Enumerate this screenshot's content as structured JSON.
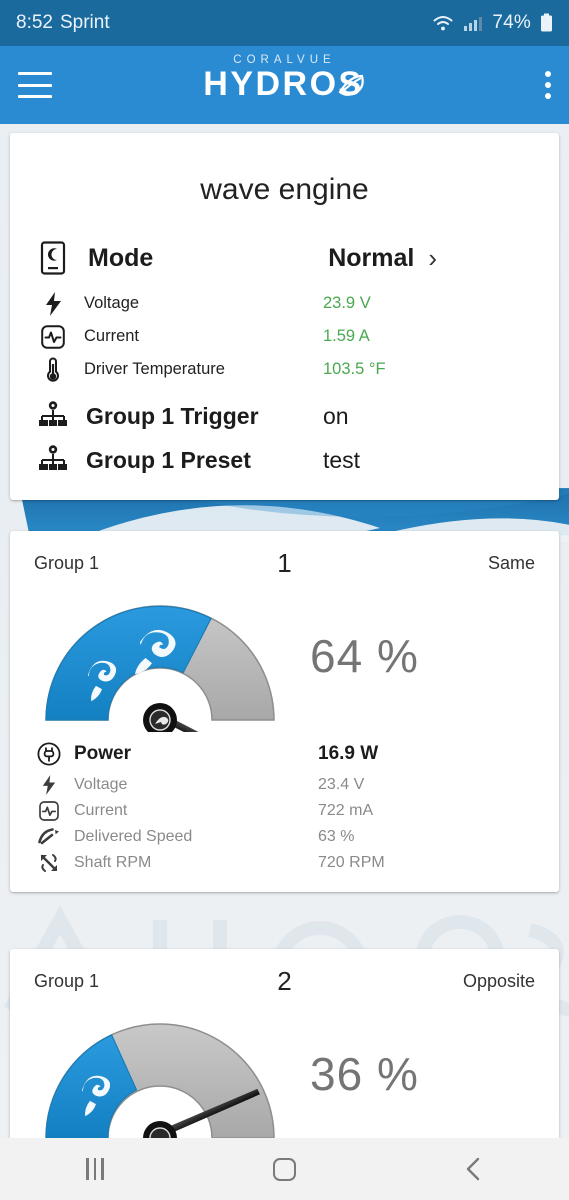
{
  "status_bar": {
    "time": "8:52",
    "carrier": "Sprint",
    "battery_pct": "74%",
    "icons": [
      "wifi-icon",
      "cellular-signal-icon",
      "battery-icon"
    ]
  },
  "app_bar": {
    "menu_icon": "hamburger-menu-icon",
    "brand_top": "CORALVUE",
    "brand_main": "HYDROS",
    "overflow_icon": "kebab-menu-icon"
  },
  "device_card": {
    "title": "wave engine",
    "mode": {
      "icon": "mode-device-icon",
      "label": "Mode",
      "value": "Normal",
      "chevron": "chevron-right-icon"
    },
    "readings": [
      {
        "icon": "bolt-icon",
        "label": "Voltage",
        "value": "23.9 V"
      },
      {
        "icon": "waveform-icon",
        "label": "Current",
        "value": "1.59 A"
      },
      {
        "icon": "thermometer-icon",
        "label": "Driver Temperature",
        "value": "103.5 °F"
      }
    ],
    "groups": [
      {
        "icon": "group-node-icon",
        "label": "Group 1 Trigger",
        "value": "on"
      },
      {
        "icon": "group-node-icon",
        "label": "Group 1 Preset",
        "value": "test"
      }
    ]
  },
  "pumps": [
    {
      "group": "Group 1",
      "index": "1",
      "sync": "Same",
      "percent_label": "64 %",
      "percent_value": 64,
      "stats": [
        {
          "icon": "power-plug-icon",
          "label": "Power",
          "value": "16.9 W"
        },
        {
          "icon": "bolt-icon",
          "label": "Voltage",
          "value": "23.4 V"
        },
        {
          "icon": "waveform-icon",
          "label": "Current",
          "value": "722 mA"
        },
        {
          "icon": "speedometer-icon",
          "label": "Delivered Speed",
          "value": "63 %"
        },
        {
          "icon": "shaft-rpm-icon",
          "label": "Shaft RPM",
          "value": "720 RPM"
        }
      ]
    },
    {
      "group": "Group 1",
      "index": "2",
      "sync": "Opposite",
      "percent_label": "36 %",
      "percent_value": 36,
      "stats": []
    }
  ],
  "nav_bar": {
    "recents_icon": "recents-icon",
    "home_icon": "home-icon",
    "back_icon": "back-icon"
  },
  "colors": {
    "status_bar": "#1b6a9e",
    "app_bar": "#2a8ad2",
    "gauge_blue": "#1f8fd0",
    "gauge_gray": "#b6b6b6",
    "value_green": "#4aa84f",
    "percent_gray": "#757575"
  }
}
